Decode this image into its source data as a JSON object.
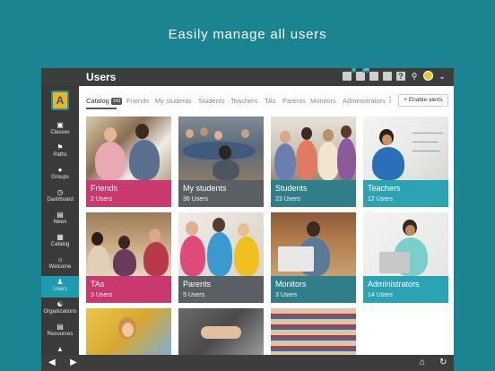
{
  "headline": "Easily manage all users",
  "header": {
    "title": "Users",
    "notification_count": "1",
    "message_count": "24"
  },
  "sidebar": {
    "logo": "A",
    "items": [
      {
        "label": "Classes",
        "icon": "classes-icon"
      },
      {
        "label": "Paths",
        "icon": "paths-icon"
      },
      {
        "label": "Groups",
        "icon": "groups-icon"
      },
      {
        "label": "Dashboard",
        "icon": "dashboard-icon"
      },
      {
        "label": "News",
        "icon": "news-icon"
      },
      {
        "label": "Catalog",
        "icon": "catalog-icon"
      },
      {
        "label": "Welcome",
        "icon": "welcome-icon"
      },
      {
        "label": "Users",
        "icon": "users-icon"
      },
      {
        "label": "Organizations",
        "icon": "organizations-icon"
      },
      {
        "label": "Resources",
        "icon": "resources-icon"
      }
    ]
  },
  "tabs": {
    "items": [
      "Catalog",
      "Friends",
      "My students",
      "Students",
      "Teachers",
      "TAs",
      "Parents",
      "Monitors",
      "Administrators"
    ],
    "catalog_count": "143",
    "enable_alerts": "+ Enable alerts"
  },
  "cards": [
    {
      "name": "Friends",
      "count": "2 Users",
      "color": "#c9396d"
    },
    {
      "name": "My students",
      "count": "36 Users",
      "color": "#5a5f63"
    },
    {
      "name": "Students",
      "count": "23 Users",
      "color": "#2f7e8a"
    },
    {
      "name": "Teachers",
      "count": "12 Users",
      "color": "#2ba3b3"
    },
    {
      "name": "TAs",
      "count": "3 Users",
      "color": "#c9396d"
    },
    {
      "name": "Parents",
      "count": "5 Users",
      "color": "#5a5f63"
    },
    {
      "name": "Monitors",
      "count": "3 Users",
      "color": "#2f7e8a"
    },
    {
      "name": "Administrators",
      "count": "14 Users",
      "color": "#2ba3b3"
    }
  ],
  "colors": {
    "background": "#1a8591",
    "topbar": "#3d3d3d",
    "sidebar": "#3a3a3a",
    "active": "#1f9bb0"
  }
}
